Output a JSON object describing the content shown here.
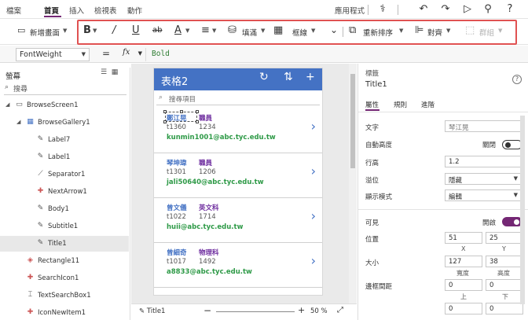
{
  "menu": {
    "items": [
      "檔案",
      "首頁",
      "插入",
      "檢視表",
      "動作"
    ],
    "app_settings": "應用程式"
  },
  "ribbon": {
    "new_screen": "新增畫面",
    "bold": "B",
    "italic": "/",
    "underline": "U",
    "strikethrough": "ab",
    "font_color": "A",
    "fill": "填滿",
    "border": "框線",
    "reorder": "重新排序",
    "align": "對齊",
    "group": "群組"
  },
  "formula": {
    "property": "FontWeight",
    "equals": "=",
    "fx": "fx",
    "value": "Bold"
  },
  "tree": {
    "title": "螢幕",
    "search_placeholder": "搜尋",
    "nodes": [
      {
        "label": "BrowseScreen1",
        "icon": "screen-icon"
      },
      {
        "label": "BrowseGallery1",
        "icon": "gallery-icon"
      },
      {
        "label": "Label7",
        "icon": "label-icon"
      },
      {
        "label": "Label1",
        "icon": "label-icon"
      },
      {
        "label": "Separator1",
        "icon": "separator-icon"
      },
      {
        "label": "NextArrow1",
        "icon": "icon-icon"
      },
      {
        "label": "Body1",
        "icon": "label-icon"
      },
      {
        "label": "Subtitle1",
        "icon": "label-icon"
      },
      {
        "label": "Title1",
        "icon": "label-icon"
      },
      {
        "label": "Rectangle11",
        "icon": "shape-icon"
      },
      {
        "label": "SearchIcon1",
        "icon": "icon-icon"
      },
      {
        "label": "TextSearchBox1",
        "icon": "textbox-icon"
      },
      {
        "label": "IconNewItem1",
        "icon": "icon-icon"
      }
    ]
  },
  "app": {
    "title": "表格2",
    "search_placeholder": "搜尋項目",
    "items": [
      {
        "name": "鄭江晃",
        "title": "職員",
        "id1": "t1360",
        "id2": "1234",
        "email": "kunmin1001@abc.tyc.edu.tw"
      },
      {
        "name": "琴坤瑋",
        "title": "職員",
        "id1": "t1301",
        "id2": "1206",
        "email": "jali50640@abc.tyc.edu.tw"
      },
      {
        "name": "曾文儀",
        "title": "英文科",
        "id1": "t1022",
        "id2": "1714",
        "email": "huii@abc.tyc.edu.tw"
      },
      {
        "name": "曾細奇",
        "title": "物理科",
        "id1": "t1017",
        "id2": "1492",
        "email": "a8833@abc.tyc.edu.tw"
      }
    ]
  },
  "status": {
    "selected": "Title1",
    "zoom": "50 %"
  },
  "props": {
    "kind": "標籤",
    "name": "Title1",
    "help": "?",
    "tabs": [
      "屬性",
      "規則",
      "進階"
    ],
    "text_label": "文字",
    "text_value": "琴江晃",
    "autoheight_label": "自動高度",
    "autoheight_state": "關閉",
    "lineheight_label": "行高",
    "lineheight_value": "1.2",
    "overflow_label": "溢位",
    "overflow_value": "隱藏",
    "display_label": "顯示模式",
    "display_value": "編輯",
    "visible_label": "可見",
    "visible_state": "開啟",
    "position_label": "位置",
    "pos_x": "51",
    "pos_y": "25",
    "x_label": "X",
    "y_label": "Y",
    "size_label": "大小",
    "width": "127",
    "height": "38",
    "width_label": "寬度",
    "height_label": "高度",
    "padding_label": "邊框間距",
    "pad_top": "0",
    "pad_bottom": "0",
    "top_label": "上",
    "bottom_label": "下",
    "pad_left": "0",
    "pad_right": "0"
  }
}
